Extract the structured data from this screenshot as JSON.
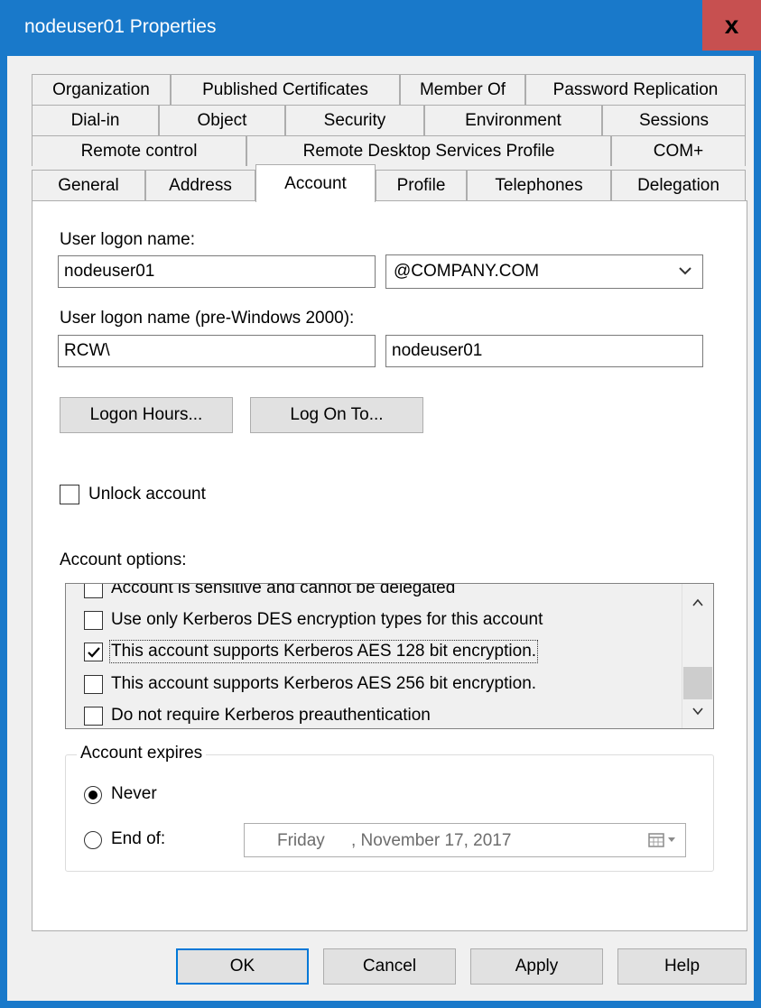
{
  "window": {
    "title": "nodeuser01 Properties",
    "close_glyph": "x"
  },
  "tabs": {
    "row1": [
      "Organization",
      "Published Certificates",
      "Member Of",
      "Password Replication"
    ],
    "row2": [
      "Dial-in",
      "Object",
      "Security",
      "Environment",
      "Sessions"
    ],
    "row3": [
      "Remote control",
      "Remote Desktop Services Profile",
      "COM+"
    ],
    "row4": [
      "General",
      "Address",
      "Account",
      "Profile",
      "Telephones",
      "Delegation"
    ],
    "active": "Account"
  },
  "account": {
    "logon_name_label": "User logon name:",
    "logon_name_value": "nodeuser01",
    "domain_suffix": "@COMPANY.COM",
    "pre2000_label": "User logon name (pre-Windows 2000):",
    "pre2000_domain": "RCW\\",
    "pre2000_user": "nodeuser01",
    "logon_hours_button": "Logon Hours...",
    "log_on_to_button": "Log On To...",
    "unlock_label": "Unlock account",
    "unlock_checked": false,
    "options_label": "Account options:",
    "options": [
      {
        "label": "Account is sensitive and cannot be delegated",
        "checked": false
      },
      {
        "label": "Use only Kerberos DES encryption types for this account",
        "checked": false
      },
      {
        "label": "This account supports Kerberos AES 128 bit encryption.",
        "checked": true
      },
      {
        "label": "This account supports Kerberos AES 256 bit encryption.",
        "checked": false
      },
      {
        "label": "Do not require Kerberos preauthentication",
        "checked": false
      }
    ],
    "expires_label": "Account expires",
    "never_label": "Never",
    "endof_label": "End of:",
    "selected_expiry": "Never",
    "date_day": "Friday",
    "date_value": ", November 17, 2017"
  },
  "buttons": {
    "ok": "OK",
    "cancel": "Cancel",
    "apply": "Apply",
    "help": "Help"
  },
  "colors": {
    "titlebar": "#1979ca",
    "close": "#c75050",
    "focus_border": "#0078d7"
  }
}
